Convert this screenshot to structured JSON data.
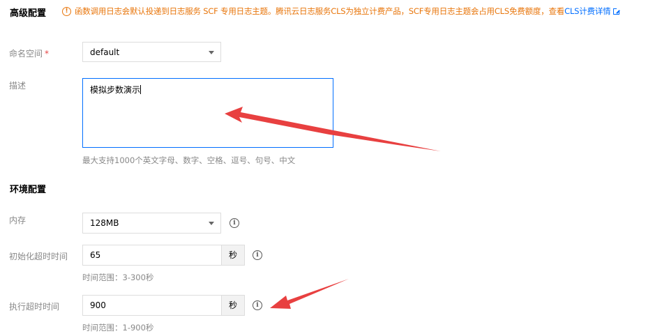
{
  "advanced": {
    "title": "高级配置",
    "notice_icon": "!",
    "notice_text": "函数调用日志会默认投递到日志服务 SCF 专用日志主题。腾讯云日志服务CLS为独立计费产品，SCF专用日志主题会占用CLS免费额度，查看",
    "notice_link": "CLS计费详情",
    "namespace_label": "命名空间",
    "required_mark": "*",
    "namespace_value": "default",
    "desc_label": "描述",
    "desc_value": "模拟步数演示",
    "desc_hint": "最大支持1000个英文字母、数字、空格、逗号、句号、中文"
  },
  "env": {
    "title": "环境配置",
    "memory_label": "内存",
    "memory_value": "128MB",
    "init_timeout_label": "初始化超时时间",
    "init_timeout_value": "65",
    "init_timeout_unit": "秒",
    "init_timeout_hint": "时间范围：3-300秒",
    "exec_timeout_label": "执行超时时间",
    "exec_timeout_value": "900",
    "exec_timeout_unit": "秒",
    "exec_timeout_hint": "时间范围：1-900秒",
    "info_glyph": "i"
  },
  "icons": {
    "notice": "warning-circle-icon",
    "external_link": "external-link-icon",
    "dropdown": "chevron-down-icon",
    "info": "info-circle-icon",
    "annotation": "red-arrow"
  },
  "colors": {
    "warning": "#e8760c",
    "link": "#006eff",
    "required": "#e54545",
    "annotation_arrow": "#e84040"
  }
}
